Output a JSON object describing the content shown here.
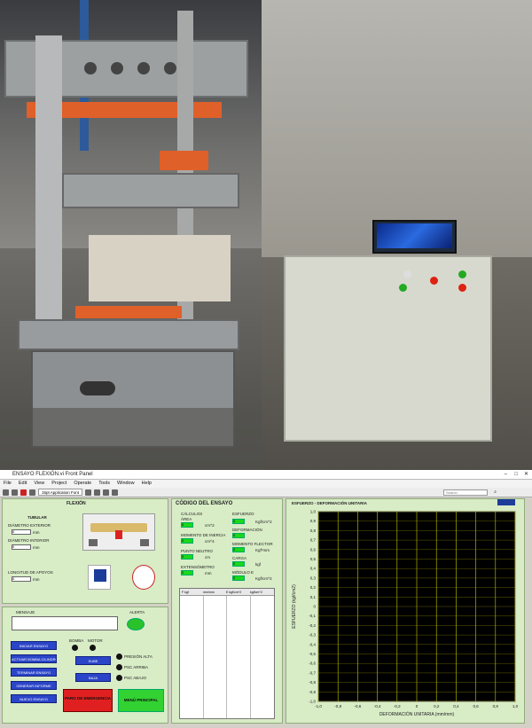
{
  "window": {
    "title": "ENSAYO FLEXIÓN.vi Front Panel",
    "menu": [
      "File",
      "Edit",
      "View",
      "Project",
      "Operate",
      "Tools",
      "Window",
      "Help"
    ],
    "font_select": "15pt Application Font",
    "search_placeholder": "Search"
  },
  "flexion": {
    "title": "FLEXIÓN",
    "section": "TUBULAR",
    "outer_label": "DIÁMETRO EXTERIOR",
    "outer_value": "0",
    "outer_unit": "mm",
    "inner_label": "DIÁMETRO INTERIOR",
    "inner_value": "0",
    "inner_unit": "mm",
    "span_label": "LONGITUD DE APOYOS",
    "span_value": "0",
    "span_unit": "mm"
  },
  "controls": {
    "message_label": "MENSAJE",
    "alert_label": "ALERTA",
    "pump_label": "BOMBA",
    "motor_label": "MOTOR",
    "buttons": [
      "INICIAR ENSAYO",
      "ACTIVAR BOMBA CILINDRO",
      "TERMINAR ENSAYO",
      "GENERAR INFORME",
      "NUEVO ENSAYO"
    ],
    "sube": "SUBE",
    "baja": "BAJA",
    "pressure_high": "PRESIÓN ALTA",
    "psc_arriba": "PSC ARRIBA",
    "psc_abajo": "PSC ABAJO",
    "emergency": "PARO DE EMERGENCIA",
    "main_menu": "MENÚ PRINCIPAL"
  },
  "codigo": {
    "title": "CÓDIGO DEL ENSAYO",
    "calc_label": "CÁLCULOS",
    "area": "ÁREA",
    "area_unit": "cm^2",
    "area_value": "0",
    "inertia": "MOMENTO DE INERCIA",
    "inertia_unit": "cm^4",
    "inertia_value": "0",
    "neutral": "PUNTO NEUTRO",
    "neutral_unit": "cm",
    "neutral_value": "0",
    "extens": "EXTENSÓMETRO",
    "extens_unit": "mm",
    "extens_value": "0",
    "stress": "ESFUERZO",
    "stress_unit": "Kgf/cm^2",
    "stress_value": "0",
    "deform": "DEFORMACIÓN",
    "deform_value": "0",
    "moment": "MOMENTO FLECTOR",
    "moment_unit": "Kgf*mm",
    "moment_value": "0",
    "load": "CARGA",
    "load_unit": "kgf",
    "load_value": "0",
    "modulus": "MÓDULO E",
    "modulus_unit": "Kgf/cm^2",
    "modulus_value": "0",
    "table_headers": [
      "F kgf",
      "mm/mm",
      "E kgf/cm^2",
      "kgf/cm^2"
    ]
  },
  "chart_data": {
    "type": "line",
    "title": "ESFUERZO - DEFORMACIÓN UNITARIA",
    "xlabel": "DEFORMACIÓN UNITARIA (mm/mm)",
    "ylabel": "ESFUERZO (kgf/cm2)",
    "xlim": [
      -1,
      1
    ],
    "ylim": [
      -1,
      1
    ],
    "xticks": [
      "-1,0",
      "-0,8",
      "-0,6",
      "-0,4",
      "-0,2",
      "0",
      "0,2",
      "0,4",
      "0,6",
      "0,8",
      "1,0"
    ],
    "yticks": [
      "1,0",
      "0,9",
      "0,8",
      "0,7",
      "0,6",
      "0,5",
      "0,4",
      "0,3",
      "0,2",
      "0,1",
      "0",
      "-0,1",
      "-0,2",
      "-0,3",
      "-0,4",
      "-0,5",
      "-0,6",
      "-0,7",
      "-0,8",
      "-0,9",
      "-1,0"
    ],
    "series": [],
    "grid": true
  },
  "colors": {
    "panel": "#d8ecc6",
    "button": "#2b45c8",
    "indicator": "#19d919",
    "plot_bg": "#000000",
    "grid": "#c8c800",
    "emergency": "#e02020"
  }
}
